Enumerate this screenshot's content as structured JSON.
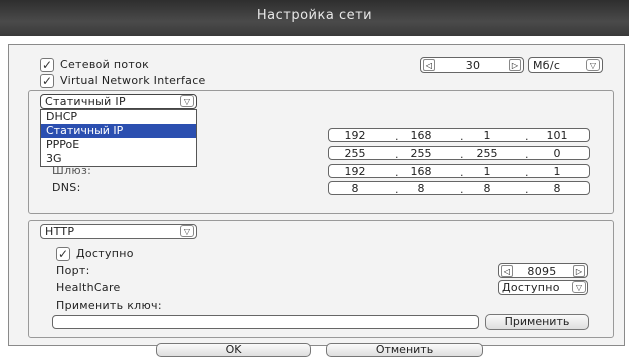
{
  "window": {
    "title": "Настройка сети"
  },
  "stream": {
    "net_stream_label": "Сетевой поток",
    "vni_label": "Virtual Network Interface",
    "value": "30",
    "unit": "Мб/с"
  },
  "network": {
    "mode_selected": "Статичный IP",
    "mode_options": [
      "DHCP",
      "Статичный IP",
      "PPPoE",
      "3G"
    ],
    "ip": [
      "192",
      "168",
      "1",
      "101"
    ],
    "mask": [
      "255",
      "255",
      "255",
      "0"
    ],
    "gateway_label": "Шлюз:",
    "gateway": [
      "192",
      "168",
      "1",
      "1"
    ],
    "dns_label": "DNS:",
    "dns": [
      "8",
      "8",
      "8",
      "8"
    ]
  },
  "service": {
    "protocol": "HTTP",
    "enabled_label": "Доступно",
    "port_label": "Порт:",
    "port": "8095",
    "healthcare_label": "HealthCare",
    "healthcare_value": "Доступно",
    "apply_key_label": "Применить ключ:",
    "apply_key_value": "",
    "apply_button": "Применить"
  },
  "footer": {
    "ok": "OK",
    "cancel": "Отменить"
  }
}
